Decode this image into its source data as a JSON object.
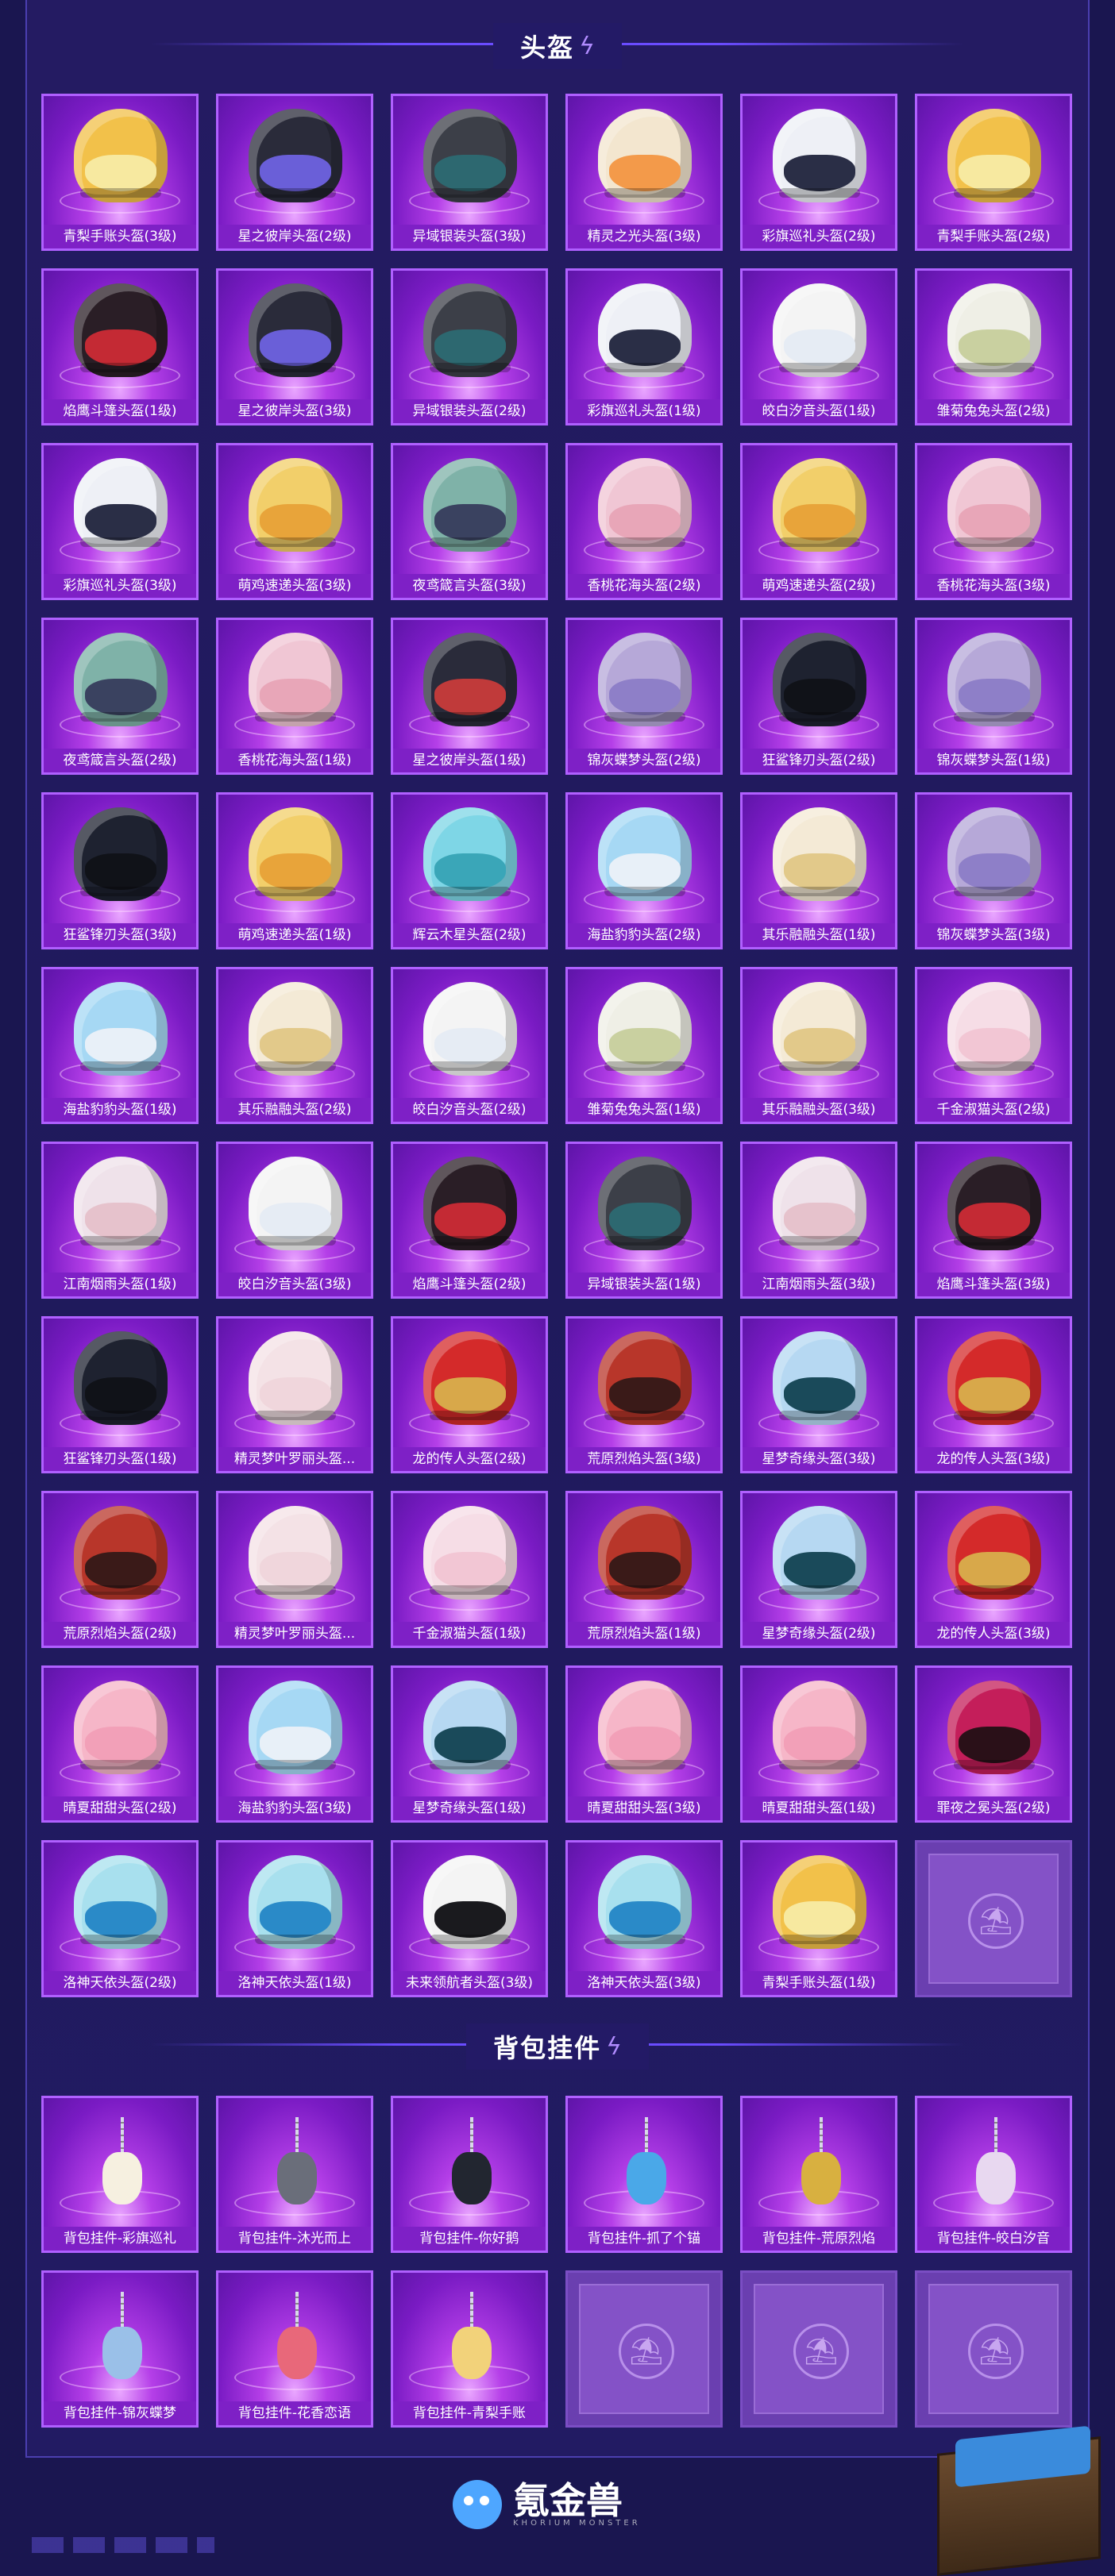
{
  "sections": {
    "helmets_title": "头盔",
    "charms_title": "背包挂件"
  },
  "helmets": [
    {
      "label": "青梨手账头盔(3级)",
      "color": "#f2c14a",
      "visor": "#f7e9a0"
    },
    {
      "label": "星之彼岸头盔(2级)",
      "color": "#2a2b3a",
      "visor": "#6a5fd8"
    },
    {
      "label": "异域银装头盔(3级)",
      "color": "#3c3f48",
      "visor": "#2d6870"
    },
    {
      "label": "精灵之光头盔(3级)",
      "color": "#f3e6cf",
      "visor": "#f39a4a"
    },
    {
      "label": "彩旗巡礼头盔(2级)",
      "color": "#eef0f6",
      "visor": "#2a2e46"
    },
    {
      "label": "青梨手账头盔(2级)",
      "color": "#f2c14a",
      "visor": "#f7e9a0"
    },
    {
      "label": "焰鹰斗篷头盔(1级)",
      "color": "#2a1e26",
      "visor": "#c42a34"
    },
    {
      "label": "星之彼岸头盔(3级)",
      "color": "#2a2b3a",
      "visor": "#6a5fd8"
    },
    {
      "label": "异域银装头盔(2级)",
      "color": "#3c3f48",
      "visor": "#2d6870"
    },
    {
      "label": "彩旗巡礼头盔(1级)",
      "color": "#eef0f6",
      "visor": "#2a2e46"
    },
    {
      "label": "皎白汐音头盔(1级)",
      "color": "#f4f4f4",
      "visor": "#e6ecf4"
    },
    {
      "label": "雏菊兔兔头盔(2级)",
      "color": "#efefe6",
      "visor": "#c9d0a0"
    },
    {
      "label": "彩旗巡礼头盔(3级)",
      "color": "#eef0f6",
      "visor": "#2a2e46"
    },
    {
      "label": "萌鸡速递头盔(3级)",
      "color": "#f2cf6a",
      "visor": "#e8a43a"
    },
    {
      "label": "夜鸢箴言头盔(3级)",
      "color": "#7fb2a8",
      "visor": "#3a4260"
    },
    {
      "label": "香桃花海头盔(2级)",
      "color": "#f0c6d4",
      "visor": "#e8a6b8"
    },
    {
      "label": "萌鸡速递头盔(2级)",
      "color": "#f2cf6a",
      "visor": "#e8a43a"
    },
    {
      "label": "香桃花海头盔(3级)",
      "color": "#f0c6d4",
      "visor": "#e8a6b8"
    },
    {
      "label": "夜鸢箴言头盔(2级)",
      "color": "#7fb2a8",
      "visor": "#3a4260"
    },
    {
      "label": "香桃花海头盔(1级)",
      "color": "#f0c6d4",
      "visor": "#e8a6b8"
    },
    {
      "label": "星之彼岸头盔(1级)",
      "color": "#2a2b3a",
      "visor": "#c03a3a"
    },
    {
      "label": "锦灰蝶梦头盔(2级)",
      "color": "#b6a8d8",
      "visor": "#8e7fc8"
    },
    {
      "label": "狂鲨锋刃头盔(2级)",
      "color": "#1e2230",
      "visor": "#101218"
    },
    {
      "label": "锦灰蝶梦头盔(1级)",
      "color": "#b6a8d8",
      "visor": "#8e7fc8"
    },
    {
      "label": "狂鲨锋刃头盔(3级)",
      "color": "#1e2230",
      "visor": "#101218"
    },
    {
      "label": "萌鸡速递头盔(1级)",
      "color": "#f2cf6a",
      "visor": "#e8a43a"
    },
    {
      "label": "辉云木星头盔(2级)",
      "color": "#7ed6e6",
      "visor": "#3aa6b8"
    },
    {
      "label": "海盐豹豹头盔(2级)",
      "color": "#a6d8f4",
      "visor": "#e8f0f8"
    },
    {
      "label": "其乐融融头盔(1级)",
      "color": "#f4ead6",
      "visor": "#e2c98a"
    },
    {
      "label": "锦灰蝶梦头盔(3级)",
      "color": "#b6a8d8",
      "visor": "#8e7fc8"
    },
    {
      "label": "海盐豹豹头盔(1级)",
      "color": "#a6d8f4",
      "visor": "#e8f0f8"
    },
    {
      "label": "其乐融融头盔(2级)",
      "color": "#f4ead6",
      "visor": "#e2c98a"
    },
    {
      "label": "皎白汐音头盔(2级)",
      "color": "#f4f4f4",
      "visor": "#e6ecf4"
    },
    {
      "label": "雏菊兔兔头盔(1级)",
      "color": "#efefe6",
      "visor": "#c9d0a0"
    },
    {
      "label": "其乐融融头盔(3级)",
      "color": "#f4ead6",
      "visor": "#e2c98a"
    },
    {
      "label": "千金淑猫头盔(2级)",
      "color": "#f6dde6",
      "visor": "#f2c6d4"
    },
    {
      "label": "江南烟雨头盔(1级)",
      "color": "#efe2ea",
      "visor": "#e6c2cc"
    },
    {
      "label": "皎白汐音头盔(3级)",
      "color": "#f4f4f4",
      "visor": "#e6ecf4"
    },
    {
      "label": "焰鹰斗篷头盔(2级)",
      "color": "#2a1e26",
      "visor": "#c42a34"
    },
    {
      "label": "异域银装头盔(1级)",
      "color": "#3c3f48",
      "visor": "#2d6870"
    },
    {
      "label": "江南烟雨头盔(3级)",
      "color": "#efe2ea",
      "visor": "#e6c2cc"
    },
    {
      "label": "焰鹰斗篷头盔(3级)",
      "color": "#2a1e26",
      "visor": "#c42a34"
    },
    {
      "label": "狂鲨锋刃头盔(1级)",
      "color": "#1e2230",
      "visor": "#101218"
    },
    {
      "label": "精灵梦叶罗丽头盔...",
      "color": "#f4e2e6",
      "visor": "#f0d6dc"
    },
    {
      "label": "龙的传人头盔(2级)",
      "color": "#d42a2a",
      "visor": "#d8a84a"
    },
    {
      "label": "荒原烈焰头盔(3级)",
      "color": "#b8362a",
      "visor": "#3a1a18"
    },
    {
      "label": "星梦奇缘头盔(3级)",
      "color": "#b6d8f2",
      "visor": "#1a4a5a"
    },
    {
      "label": "龙的传人头盔(3级)",
      "color": "#d42a2a",
      "visor": "#d8a84a"
    },
    {
      "label": "荒原烈焰头盔(2级)",
      "color": "#b8362a",
      "visor": "#3a1a18"
    },
    {
      "label": "精灵梦叶罗丽头盔...",
      "color": "#f4e2e6",
      "visor": "#f0d6dc"
    },
    {
      "label": "千金淑猫头盔(1级)",
      "color": "#f6dde6",
      "visor": "#f2c6d4"
    },
    {
      "label": "荒原烈焰头盔(1级)",
      "color": "#b8362a",
      "visor": "#3a1a18"
    },
    {
      "label": "星梦奇缘头盔(2级)",
      "color": "#b6d8f2",
      "visor": "#1a4a5a"
    },
    {
      "label": "龙的传人头盔(3级)",
      "color": "#d42a2a",
      "visor": "#d8a84a"
    },
    {
      "label": "晴夏甜甜头盔(2级)",
      "color": "#f6b6c8",
      "visor": "#f2a0b8"
    },
    {
      "label": "海盐豹豹头盔(3级)",
      "color": "#a6d8f4",
      "visor": "#e8f0f8"
    },
    {
      "label": "星梦奇缘头盔(1级)",
      "color": "#b6d8f2",
      "visor": "#1a4a5a"
    },
    {
      "label": "晴夏甜甜头盔(3级)",
      "color": "#f6b6c8",
      "visor": "#f2a0b8"
    },
    {
      "label": "晴夏甜甜头盔(1级)",
      "color": "#f6b6c8",
      "visor": "#f2a0b8"
    },
    {
      "label": "罪夜之冕头盔(2级)",
      "color": "#c41e5a",
      "visor": "#2a1018"
    },
    {
      "label": "洛神天依头盔(2级)",
      "color": "#a8e0ee",
      "visor": "#2a8ac8"
    },
    {
      "label": "洛神天依头盔(1级)",
      "color": "#a8e0ee",
      "visor": "#2a8ac8"
    },
    {
      "label": "未来领航者头盔(3级)",
      "color": "#f4f4f4",
      "visor": "#1a1a1e"
    },
    {
      "label": "洛神天依头盔(3级)",
      "color": "#a8e0ee",
      "visor": "#2a8ac8"
    },
    {
      "label": "青梨手账头盔(1级)",
      "color": "#f2c14a",
      "visor": "#f7e9a0"
    }
  ],
  "charms": [
    {
      "label": "背包挂件-彩旗巡礼",
      "color": "#f6f0e0"
    },
    {
      "label": "背包挂件-沐光而上",
      "color": "#6a6e7a"
    },
    {
      "label": "背包挂件-你好鹅",
      "color": "#222630"
    },
    {
      "label": "背包挂件-抓了个锚",
      "color": "#4aa8e8"
    },
    {
      "label": "背包挂件-荒原烈焰",
      "color": "#d8b040"
    },
    {
      "label": "背包挂件-皎白汐音",
      "color": "#e8d8f0"
    },
    {
      "label": "背包挂件-锦灰蝶梦",
      "color": "#9ac0e8"
    },
    {
      "label": "背包挂件-花香恋语",
      "color": "#e8687a"
    },
    {
      "label": "背包挂件-青梨手账",
      "color": "#f2d27a"
    }
  ],
  "empty_slot_icon": "parachute-crate-icon",
  "footer": {
    "brand": "氪金兽",
    "sub": "KHORIUM MONSTER"
  }
}
